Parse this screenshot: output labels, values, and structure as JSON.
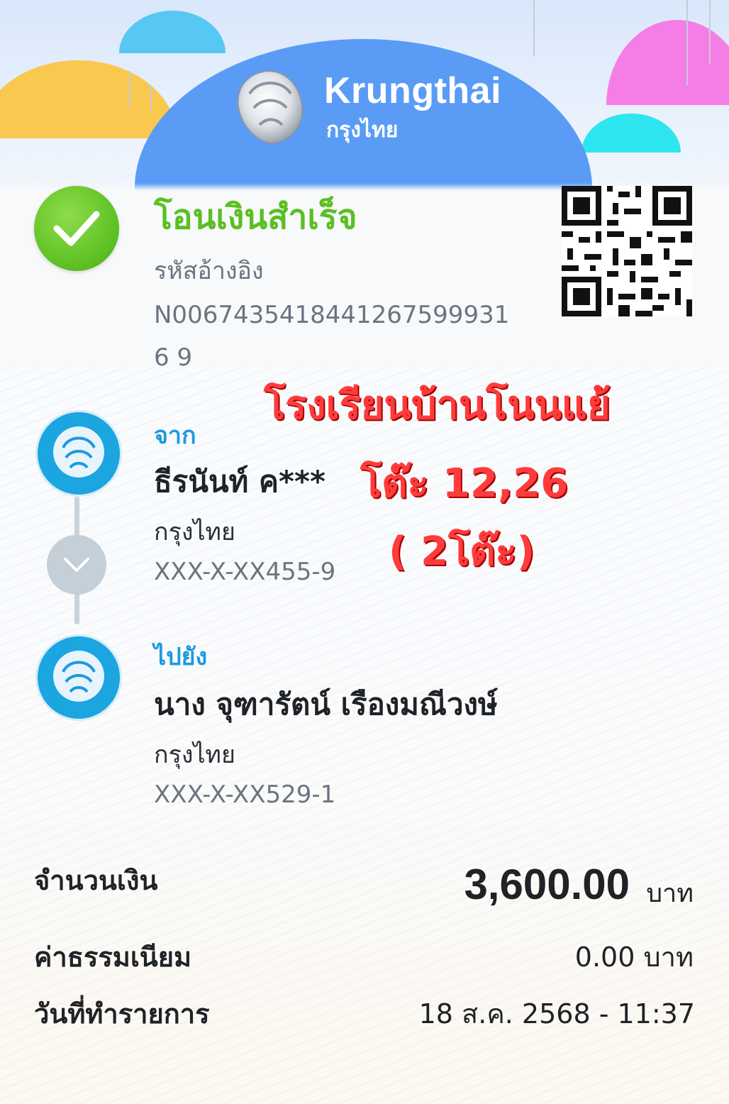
{
  "brand": {
    "name_en": "Krungthai",
    "name_th": "กรุงไทย"
  },
  "status": {
    "title": "โอนเงินสำเร็จ",
    "ref_label": "รหัสอ้างอิง",
    "ref_number": "N00674354184412675999316 9"
  },
  "from": {
    "label": "จาก",
    "name": "ธีรนันท์ ค***",
    "bank": "กรุงไทย",
    "account": "XXX-X-XX455-9"
  },
  "to": {
    "label": "ไปยัง",
    "name": "นาง จุฑารัตน์ เรืองมณีวงษ์",
    "bank": "กรุงไทย",
    "account": "XXX-X-XX529-1"
  },
  "overlay_note": {
    "line1": "โรงเรียนบ้านโนนแย้",
    "line2": "โต๊ะ 12,26",
    "line3": "( 2โต๊ะ)"
  },
  "details": {
    "amount_label": "จำนวนเงิน",
    "amount_value": "3,600.00",
    "amount_unit": "บาท",
    "fee_label": "ค่าธรรมเนียม",
    "fee_value": "0.00 บาท",
    "date_label": "วันที่ทำรายการ",
    "date_value": "18 ส.ค. 2568 - 11:37"
  },
  "colors": {
    "success_green": "#5bbf22",
    "link_blue": "#1b9ae0",
    "brand_blue": "#5a9bf6",
    "overlay_red": "#ff3b3b"
  },
  "icons": {
    "status": "check-icon",
    "bank_logo": "krungthai-garuda-icon",
    "expand": "chevron-down-icon",
    "qr": "qr-code-icon"
  }
}
